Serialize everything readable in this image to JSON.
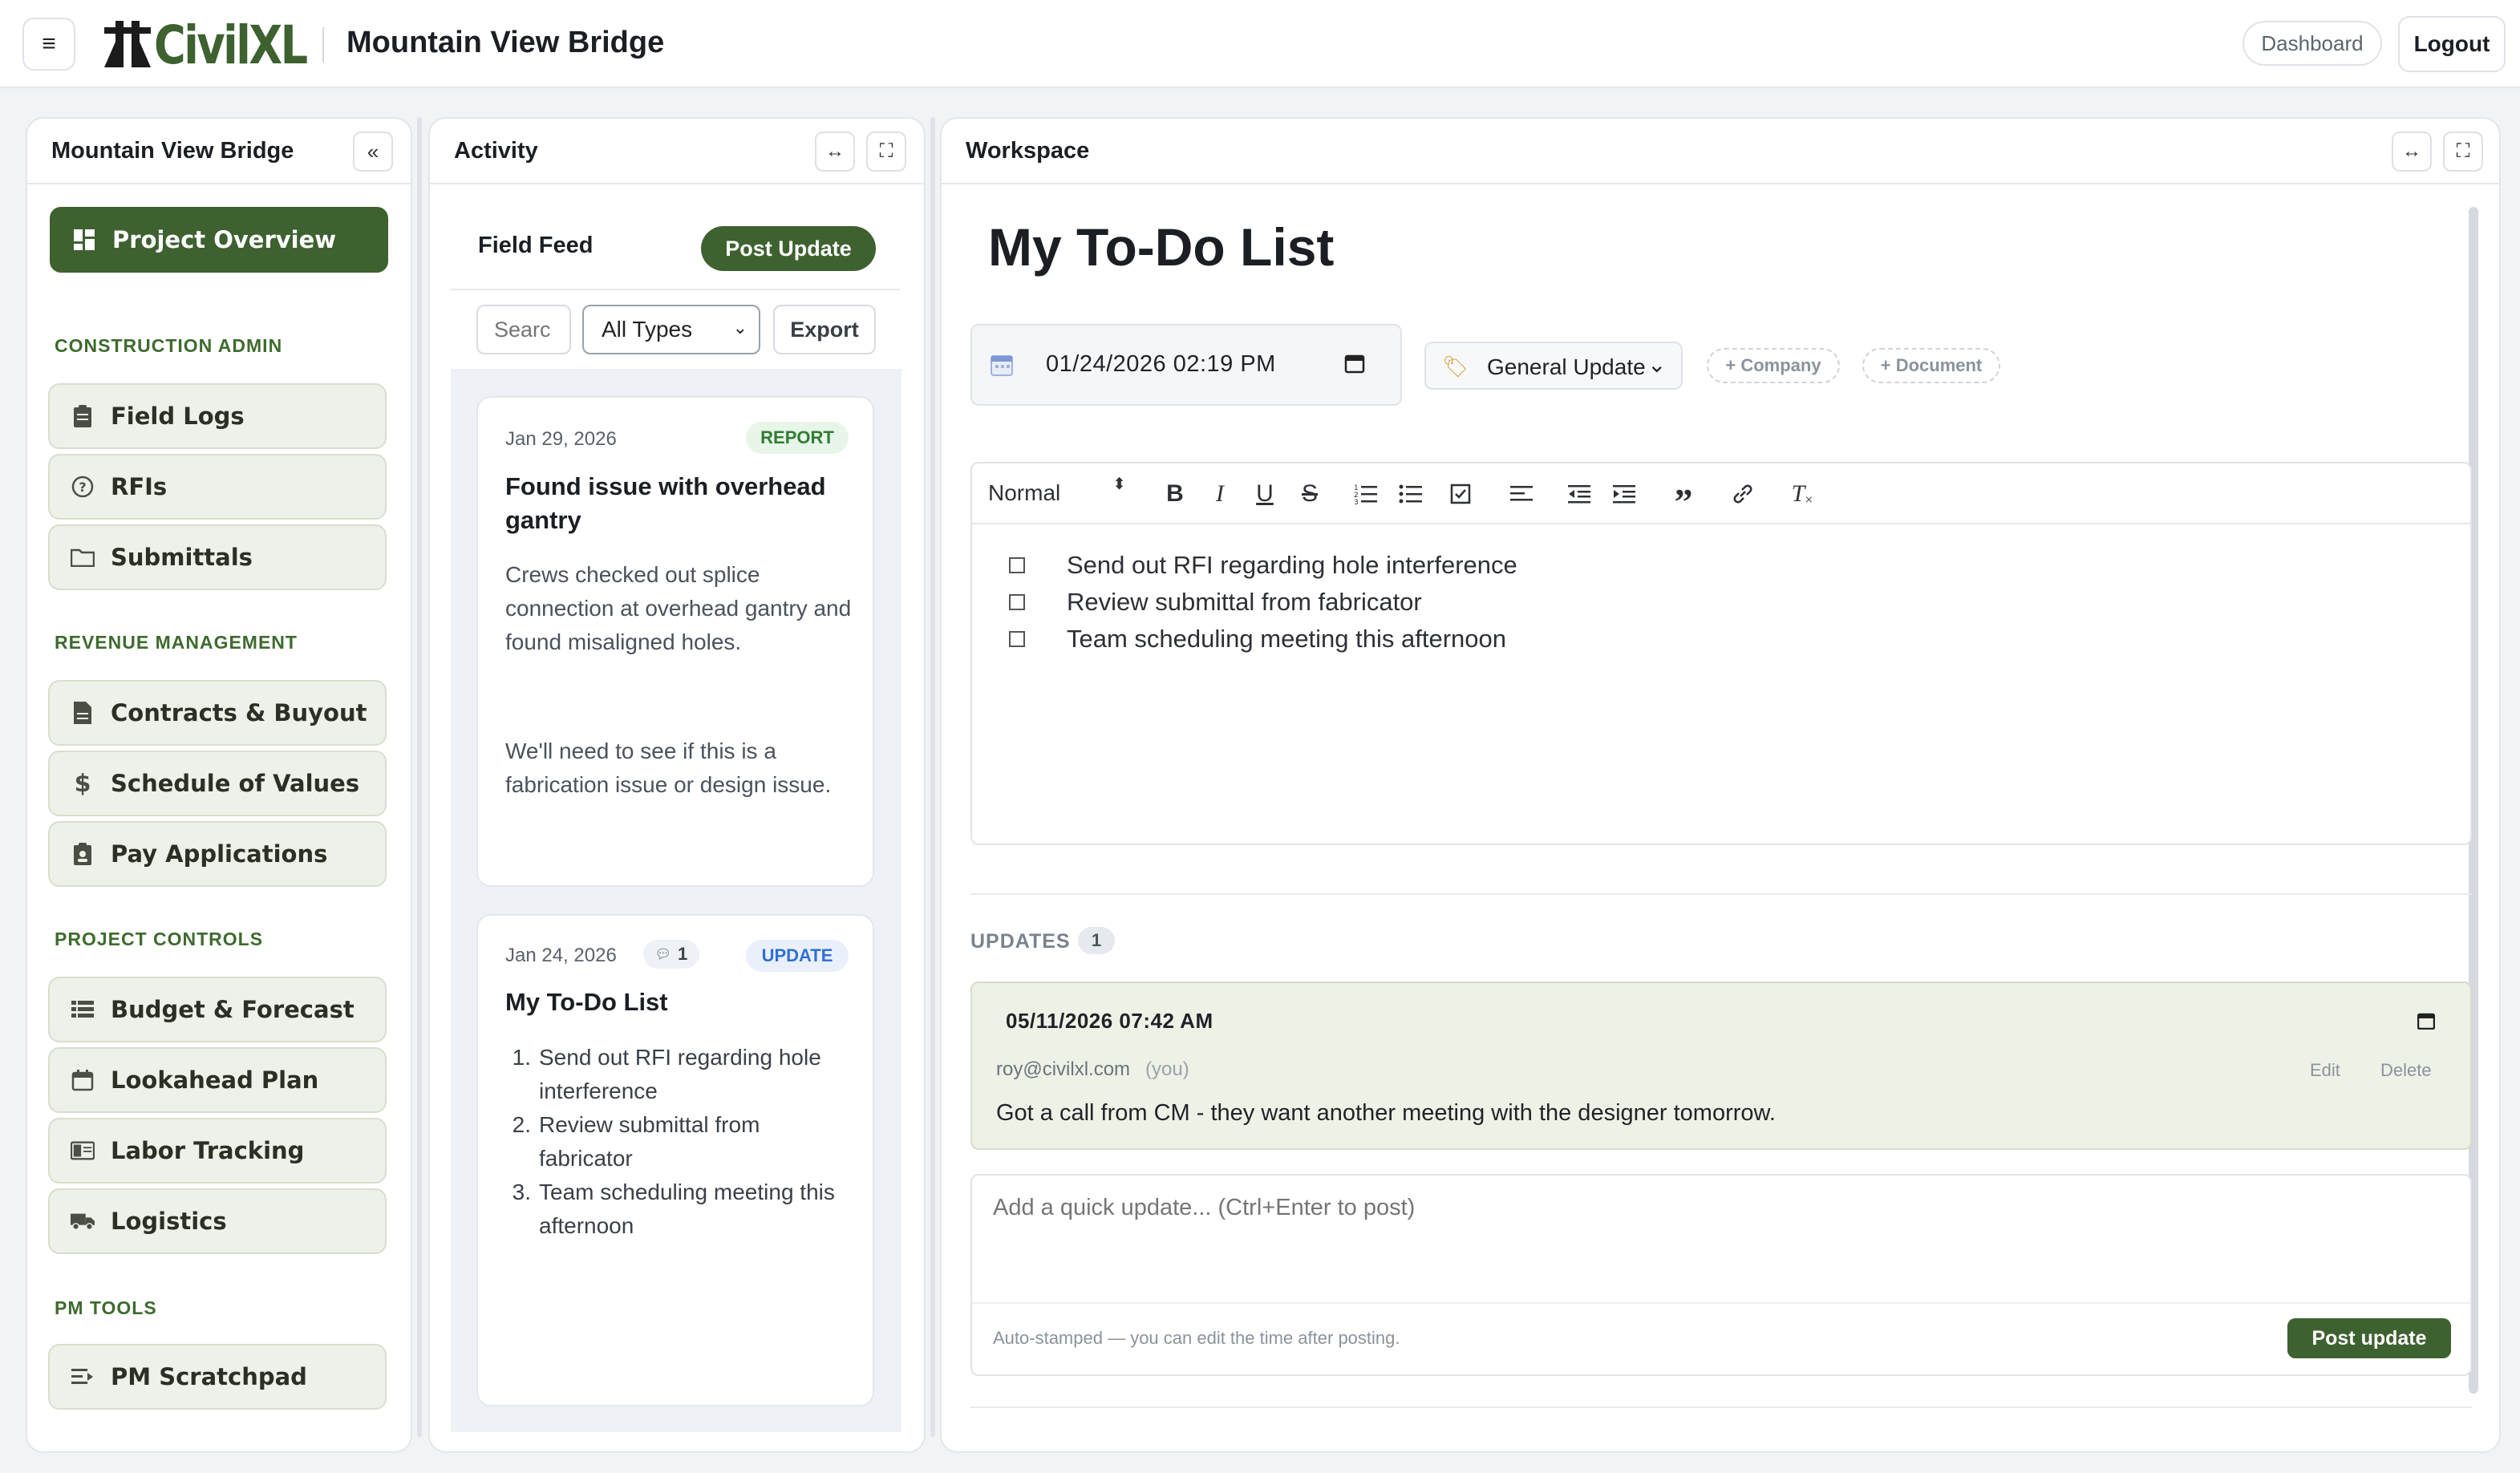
{
  "header": {
    "app_name": "CivilXL",
    "project": "Mountain View Bridge",
    "dashboard": "Dashboard",
    "logout": "Logout",
    "menu_icon": "hamburger-icon"
  },
  "sidebar": {
    "title": "Mountain View Bridge",
    "collapse": "«",
    "overview": "Project Overview",
    "sections": [
      {
        "label": "CONSTRUCTION ADMIN",
        "items": [
          "Field Logs",
          "RFIs",
          "Submittals"
        ]
      },
      {
        "label": "REVENUE MANAGEMENT",
        "items": [
          "Contracts & Buyout",
          "Schedule of Values",
          "Pay Applications"
        ]
      },
      {
        "label": "PROJECT CONTROLS",
        "items": [
          "Budget & Forecast",
          "Lookahead Plan",
          "Labor Tracking",
          "Logistics"
        ]
      },
      {
        "label": "PM TOOLS",
        "items": [
          "PM Scratchpad"
        ]
      }
    ]
  },
  "activity": {
    "title": "Activity",
    "expand": "↔",
    "fullscreen": "⛶",
    "feed_title": "Field Feed",
    "post_update": "Post Update",
    "search_placeholder": "Searc",
    "type_filter": "All Types",
    "export": "Export",
    "cards": [
      {
        "date": "Jan 29, 2026",
        "badge": "REPORT",
        "title": "Found issue with overhead gantry",
        "p1": "Crews checked out splice connection at overhead gantry and found misaligned holes.",
        "p2": "We'll need to see if this is a fabrication issue or design issue."
      },
      {
        "date": "Jan 24, 2026",
        "comments": "1",
        "badge": "UPDATE",
        "title": "My To-Do List",
        "items": [
          "Send out RFI regarding hole interference",
          "Review submittal from fabricator",
          "Team scheduling meeting this afternoon"
        ]
      }
    ]
  },
  "workspace": {
    "title": "Workspace",
    "doc_title": "My To-Do List",
    "datetime": "01/24/2026 02:19 PM",
    "type": "General Update",
    "add_company": "+ Company",
    "add_document": "+ Document",
    "format": "Normal",
    "todos": [
      "Send out RFI regarding hole interference",
      "Review submittal from fabricator",
      "Team scheduling meeting this afternoon"
    ],
    "updates_label": "UPDATES",
    "updates_count": "1",
    "update": {
      "datetime": "05/11/2026 07:42 AM",
      "author": "roy@civilxl.com",
      "you": "(you)",
      "edit": "Edit",
      "delete": "Delete",
      "text": "Got a call from CM - they want another meeting with the designer tomorrow."
    },
    "quick_placeholder": "Add a quick update... (Ctrl+Enter to post)",
    "hint": "Auto-stamped — you can edit the time after posting.",
    "post_btn": "Post update"
  },
  "colors": {
    "brand": "#3e6130",
    "accent": "#2e7d32",
    "update_badge": "#2f6fd6"
  }
}
